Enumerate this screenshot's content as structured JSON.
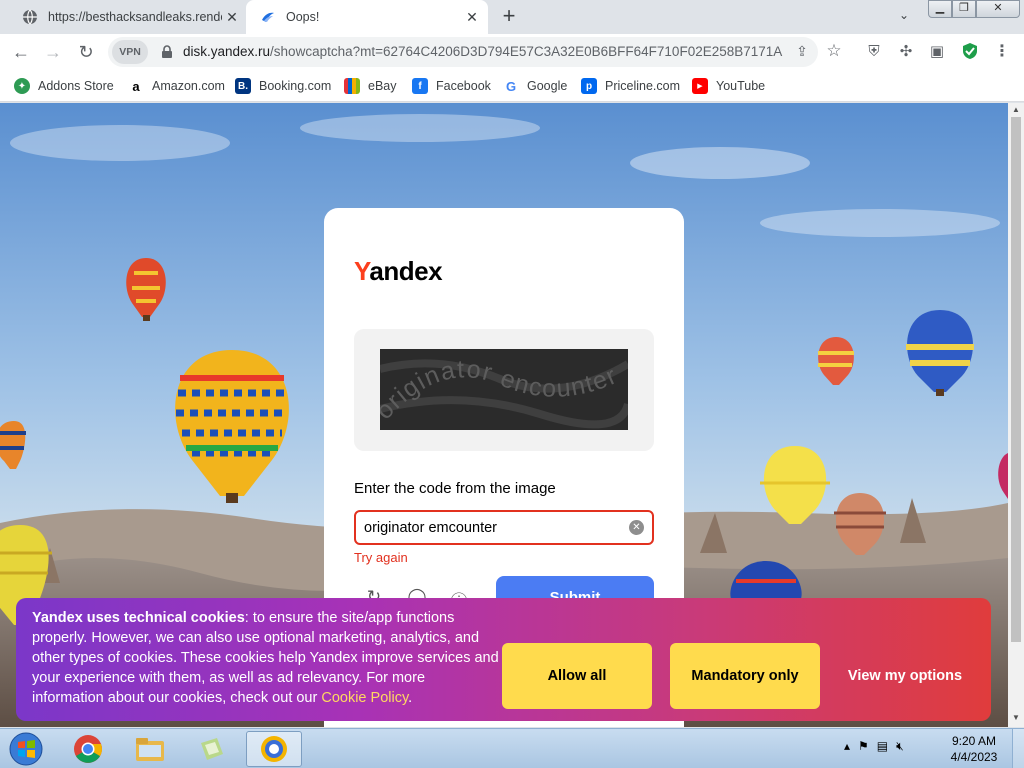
{
  "browser": {
    "tabs": [
      {
        "title": "https://besthacksandleaks.rende",
        "favicon": "globe-icon",
        "active": false
      },
      {
        "title": "Oops!",
        "favicon": "yandex-disk-icon",
        "active": true
      }
    ],
    "url_host": "disk.yandex.ru",
    "url_path": "/showcaptcha?mt=62764C4206D3D794E57C3A32E0B6BFF64F710F02E258B7171A...",
    "vpn_label": "VPN",
    "bookmarks": [
      {
        "label": "Addons Store",
        "icon": "addons-store-icon",
        "color": "#2e9b54"
      },
      {
        "label": "Amazon.com",
        "icon": "amazon-icon",
        "color": "#ffffff"
      },
      {
        "label": "Booking.com",
        "icon": "booking-icon",
        "color": "#003580"
      },
      {
        "label": "eBay",
        "icon": "ebay-icon",
        "color": "#ffffff"
      },
      {
        "label": "Facebook",
        "icon": "facebook-icon",
        "color": "#1877f2"
      },
      {
        "label": "Google",
        "icon": "google-icon",
        "color": "#ffffff"
      },
      {
        "label": "Priceline.com",
        "icon": "priceline-icon",
        "color": "#0068ef"
      },
      {
        "label": "YouTube",
        "icon": "youtube-icon",
        "color": "#ff0000"
      }
    ]
  },
  "captcha_page": {
    "logo_first": "Y",
    "logo_rest": "andex",
    "captcha_text": "originator encounter",
    "prompt": "Enter the code from the image",
    "input_value": "originator emcounter",
    "error": "Try again",
    "submit_label": "Submit"
  },
  "cookie_banner": {
    "bold": "Yandex uses technical cookies",
    "body": ": to ensure the site/app functions properly. However, we can also use optional marketing, analytics, and other types of cookies. These cookies help Yandex improve services and your experience with them, as well as ad relevancy. For more information about our cookies, check out our ",
    "link": "Cookie Policy",
    "tail": ".",
    "allow_all": "Allow all",
    "mandatory_only": "Mandatory only",
    "view_options": "View my options"
  },
  "taskbar": {
    "time": "9:20 AM",
    "date": "4/4/2023"
  },
  "colors": {
    "yandex_red": "#fc3f1d",
    "submit_blue": "#4b7cf3",
    "cookie_yellow": "#ffdb4d",
    "error_red": "#e2311f"
  }
}
